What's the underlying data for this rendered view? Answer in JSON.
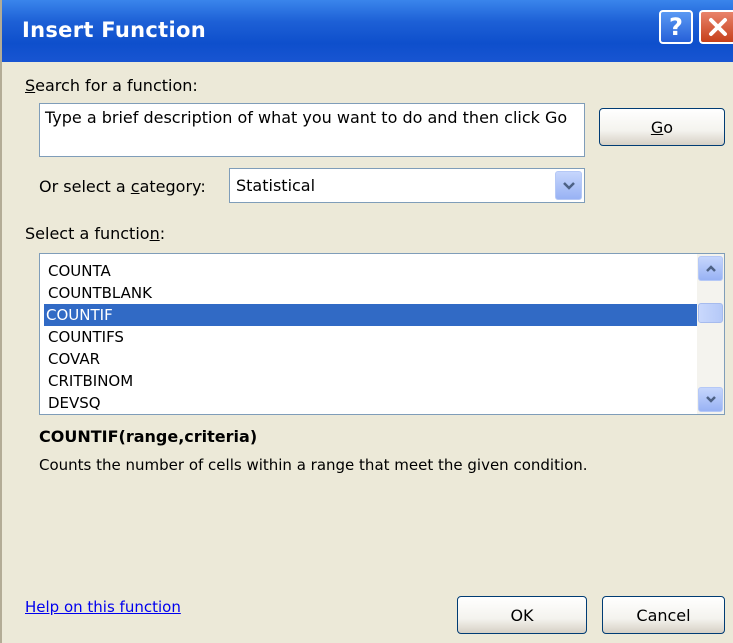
{
  "window": {
    "title": "Insert Function",
    "help_button": "?",
    "close_icon": "close-icon"
  },
  "search": {
    "label_accel": "S",
    "label_rest": "earch for a function:",
    "value": "Type a brief description of what you want to do and then click Go",
    "go_accel": "G",
    "go_rest": "o"
  },
  "category": {
    "label_pre": "Or select a ",
    "label_accel": "c",
    "label_post": "ategory:",
    "selected": "Statistical"
  },
  "functions": {
    "label_pre": "Select a functio",
    "label_accel": "n",
    "label_post": ":",
    "items": [
      "COUNTA",
      "COUNTBLANK",
      "COUNTIF",
      "COUNTIFS",
      "COVAR",
      "CRITBINOM",
      "DEVSQ"
    ],
    "selected_index": 2
  },
  "detail": {
    "signature": "COUNTIF(range,criteria)",
    "description": "Counts the number of cells within a range that meet the given condition."
  },
  "footer": {
    "help_link": "Help on this function",
    "ok_label": "OK",
    "cancel_label": "Cancel"
  },
  "colors": {
    "title_bar": "#0e4fcc",
    "selection": "#316ac5",
    "dialog_bg": "#ece9d8",
    "link": "#0000ee"
  }
}
